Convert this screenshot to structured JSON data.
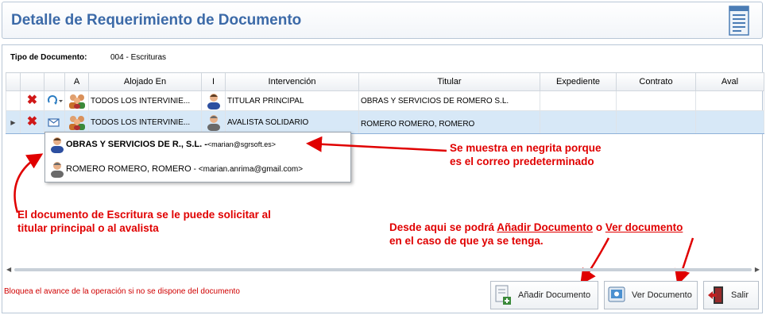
{
  "header": {
    "title": "Detalle de Requerimiento de Documento"
  },
  "tipo": {
    "label": "Tipo de Documento:",
    "value": "004 - Escrituras"
  },
  "columns": [
    "",
    "",
    "",
    "A",
    "Alojado En",
    "I",
    "Intervención",
    "Titular",
    "Expediente",
    "Contrato",
    "Aval"
  ],
  "rows": [
    {
      "alojado": "TODOS LOS INTERVINIE...",
      "intervencion": "TITULAR PRINCIPAL",
      "titular": "OBRAS Y SERVICIOS DE ROMERO S.L.",
      "expediente": "",
      "contrato": "",
      "aval": ""
    },
    {
      "alojado": "TODOS LOS INTERVINIE...",
      "intervencion": "AVALISTA SOLIDARIO",
      "titular": "ROMERO ROMERO,  ROMERO",
      "expediente": "",
      "contrato": "",
      "aval": ""
    }
  ],
  "dropdown": [
    {
      "name": "OBRAS Y SERVICIOS DE R., S.L. - ",
      "email": "<marian@sgrsoft.es>"
    },
    {
      "name": "ROMERO ROMERO,  ROMERO",
      "email": "- <marian.anrima@gmail.com>"
    }
  ],
  "annotations": {
    "bold_1": "Se muestra en negrita porque",
    "bold_2": "es el correo predeterminado",
    "left_1": "El documento de Escritura se le puede solicitar al",
    "left_2": "titular principal o al avalista",
    "right_1_a": "Desde aqui se podrá ",
    "right_1_b": "Añadir Documento",
    "right_1_c": " o ",
    "right_1_d": "Ver documento",
    "right_2": "en el caso de que ya se tenga."
  },
  "warning": "Bloquea el avance de la operación si no se dispone del documento",
  "buttons": {
    "add": "Añadir Documento",
    "view": "Ver Documento",
    "exit": "Salir"
  },
  "colors": {
    "title": "#3c6aa8",
    "annotation": "#e00000",
    "selected_row": "#d7e8f7"
  }
}
